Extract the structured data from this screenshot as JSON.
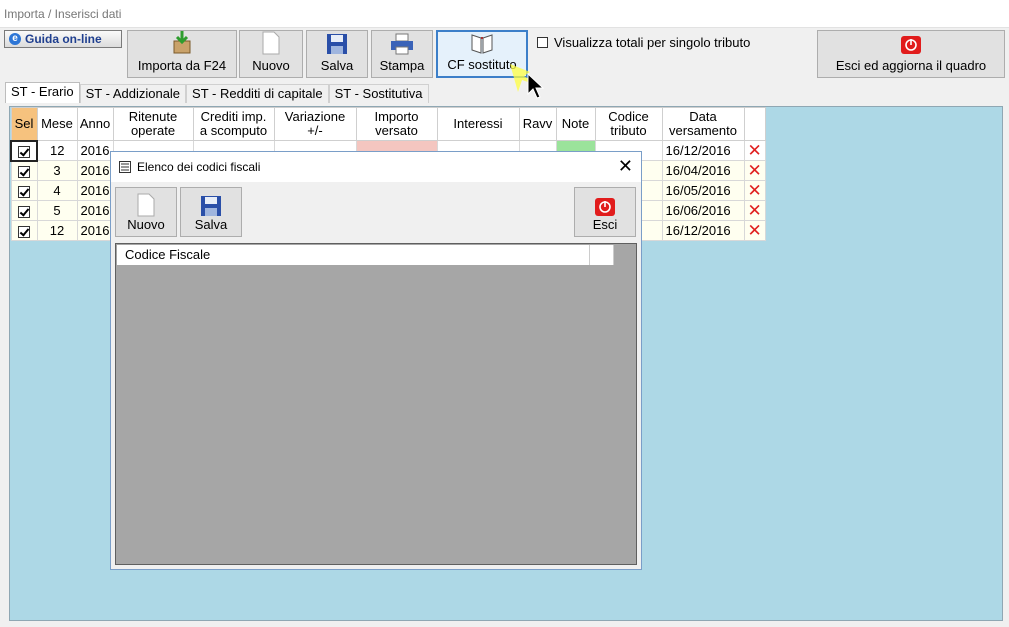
{
  "window": {
    "title": "Importa / Inserisci dati"
  },
  "toolbar": {
    "help_label": "Guida on-line",
    "import_label": "Importa da F24",
    "new_label": "Nuovo",
    "save_label": "Salva",
    "print_label": "Stampa",
    "cf_label": "CF sostituto",
    "totals_checkbox_label": "Visualizza totali per singolo tributo",
    "exit_label": "Esci ed aggiorna il quadro"
  },
  "tabs": [
    {
      "label": "ST - Erario"
    },
    {
      "label": "ST - Addizionale"
    },
    {
      "label": "ST - Redditi di capitale"
    },
    {
      "label": "ST - Sostitutiva"
    }
  ],
  "grid": {
    "headers": {
      "sel": "Sel",
      "mese": "Mese",
      "anno": "Anno",
      "ritenute": "Ritenute operate",
      "crediti": "Crediti imp. a scomputo",
      "variazione": "Variazione +/-",
      "importo": "Importo versato",
      "interessi": "Interessi",
      "ravv": "Ravv",
      "note": "Note",
      "codice": "Codice tributo",
      "data": "Data versamento"
    },
    "rows": [
      {
        "mese": "12",
        "anno": "2016",
        "data": "16/12/2016"
      },
      {
        "mese": "3",
        "anno": "2016",
        "data": "16/04/2016"
      },
      {
        "mese": "4",
        "anno": "2016",
        "data": "16/05/2016"
      },
      {
        "mese": "5",
        "anno": "2016",
        "data": "16/06/2016"
      },
      {
        "mese": "12",
        "anno": "2016",
        "data": "16/12/2016"
      }
    ]
  },
  "dialog": {
    "title": "Elenco dei codici fiscali",
    "new_label": "Nuovo",
    "save_label": "Salva",
    "exit_label": "Esci",
    "column_header": "Codice Fiscale"
  },
  "colors": {
    "panel": "#add8e6",
    "sel_header": "#f6c27e",
    "note": "#9be39b",
    "accent": "#3c7fc9"
  }
}
